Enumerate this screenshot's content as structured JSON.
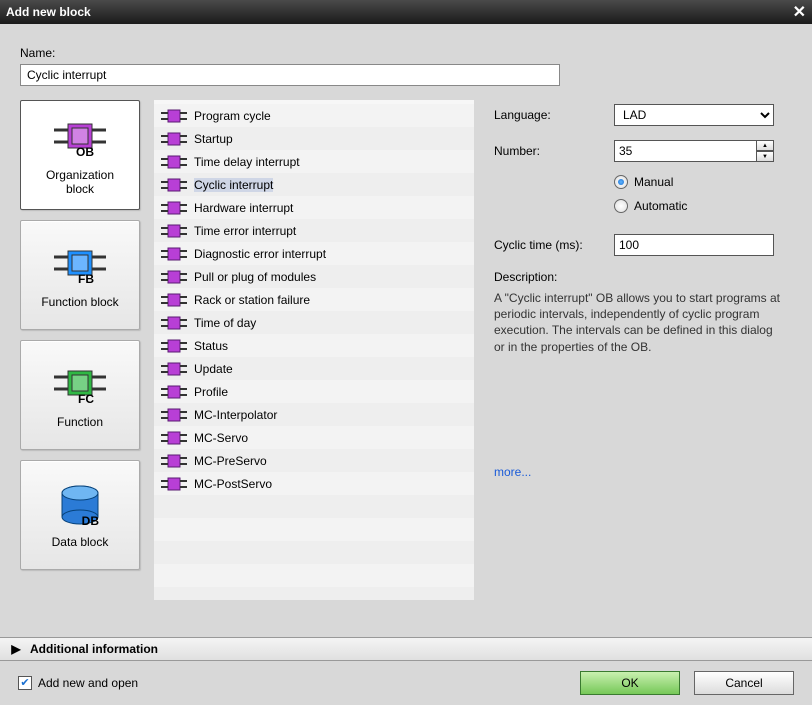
{
  "title": "Add new block",
  "name_label": "Name:",
  "name_value": "Cyclic interrupt",
  "block_types": [
    {
      "id": "ob",
      "label": "Organization\nblock",
      "tag": "OB",
      "color": "#b83fd6",
      "selected": true
    },
    {
      "id": "fb",
      "label": "Function block",
      "tag": "FB",
      "color": "#1e90ff",
      "selected": false
    },
    {
      "id": "fc",
      "label": "Function",
      "tag": "FC",
      "color": "#2fb844",
      "selected": false
    },
    {
      "id": "db",
      "label": "Data block",
      "tag": "DB",
      "color": "#2b7bd6",
      "selected": false,
      "cyl": true
    }
  ],
  "ob_list": [
    "Program cycle",
    "Startup",
    "Time delay interrupt",
    "Cyclic interrupt",
    "Hardware interrupt",
    "Time error interrupt",
    "Diagnostic error interrupt",
    "Pull or plug of modules",
    "Rack or station failure",
    "Time of day",
    "Status",
    "Update",
    "Profile",
    "MC-Interpolator",
    "MC-Servo",
    "MC-PreServo",
    "MC-PostServo"
  ],
  "ob_selected_index": 3,
  "language_label": "Language:",
  "language_value": "LAD",
  "number_label": "Number:",
  "number_value": "35",
  "mode_manual": "Manual",
  "mode_auto": "Automatic",
  "mode_selected": "manual",
  "cyclic_label": "Cyclic time (ms):",
  "cyclic_value": "100",
  "desc_head": "Description:",
  "desc_body": "A \"Cyclic interrupt\" OB allows you to start programs at periodic intervals, independently of cyclic program execution. The intervals can be defined in this dialog or in the properties of the OB.",
  "more": "more...",
  "add_info": "Additional information",
  "add_open_label": "Add new and open",
  "add_open_checked": true,
  "ok": "OK",
  "cancel": "Cancel"
}
